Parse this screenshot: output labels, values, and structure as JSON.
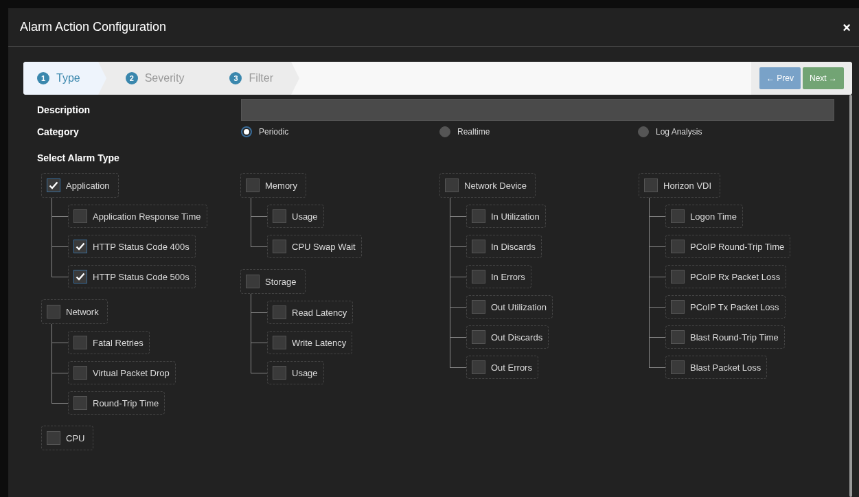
{
  "modal": {
    "title": "Alarm Action Configuration",
    "close": "×"
  },
  "wizard": {
    "steps": [
      {
        "number": "1",
        "label": "Type",
        "selected": true
      },
      {
        "number": "2",
        "label": "Severity",
        "selected": false
      },
      {
        "number": "3",
        "label": "Filter",
        "selected": false
      }
    ],
    "buttons": [
      {
        "kind": "prev",
        "label": "← Prev"
      },
      {
        "kind": "next",
        "label": "Next →"
      }
    ]
  },
  "form": {
    "description": {
      "label": "Description"
    },
    "category": {
      "label": "Category",
      "options": [
        {
          "label": "Periodic",
          "selected": true
        },
        {
          "label": "Realtime",
          "selected": false
        },
        {
          "label": "Log Analysis",
          "selected": false
        }
      ]
    },
    "alarm_type": {
      "label": "Select Alarm Type",
      "columns": [
        [
          {
            "label": "Application",
            "checked": true,
            "children": [
              {
                "label": "Application Response Time",
                "checked": false
              },
              {
                "label": "HTTP Status Code 400s",
                "checked": true
              },
              {
                "label": "HTTP Status Code 500s",
                "checked": true
              }
            ]
          },
          {
            "label": "Network",
            "checked": false,
            "children": [
              {
                "label": "Fatal Retries",
                "checked": false
              },
              {
                "label": "Virtual Packet Drop",
                "checked": false
              },
              {
                "label": "Round-Trip Time",
                "checked": false
              }
            ]
          },
          {
            "label": "CPU",
            "checked": false
          }
        ],
        [
          {
            "label": "Memory",
            "checked": false,
            "children": [
              {
                "label": "Usage",
                "checked": false
              },
              {
                "label": "CPU Swap Wait",
                "checked": false
              }
            ]
          },
          {
            "label": "Storage",
            "checked": false,
            "children": [
              {
                "label": "Read Latency",
                "checked": false
              },
              {
                "label": "Write Latency",
                "checked": false
              },
              {
                "label": "Usage",
                "checked": false
              }
            ]
          }
        ],
        [
          {
            "label": "Network Device",
            "checked": false,
            "children": [
              {
                "label": "In Utilization",
                "checked": false
              },
              {
                "label": "In Discards",
                "checked": false
              },
              {
                "label": "In Errors",
                "checked": false
              },
              {
                "label": "Out Utilization",
                "checked": false
              },
              {
                "label": "Out Discards",
                "checked": false
              },
              {
                "label": "Out Errors",
                "checked": false
              }
            ]
          }
        ],
        [
          {
            "label": "Horizon VDI",
            "checked": false,
            "children": [
              {
                "label": "Logon Time",
                "checked": false
              },
              {
                "label": "PCoIP Round-Trip Time",
                "checked": false
              },
              {
                "label": "PCoIP Rx Packet Loss",
                "checked": false
              },
              {
                "label": "PCoIP Tx Packet Loss",
                "checked": false
              },
              {
                "label": "Blast Round-Trip Time",
                "checked": false
              },
              {
                "label": "Blast Packet Loss",
                "checked": false
              }
            ]
          }
        ]
      ]
    }
  }
}
